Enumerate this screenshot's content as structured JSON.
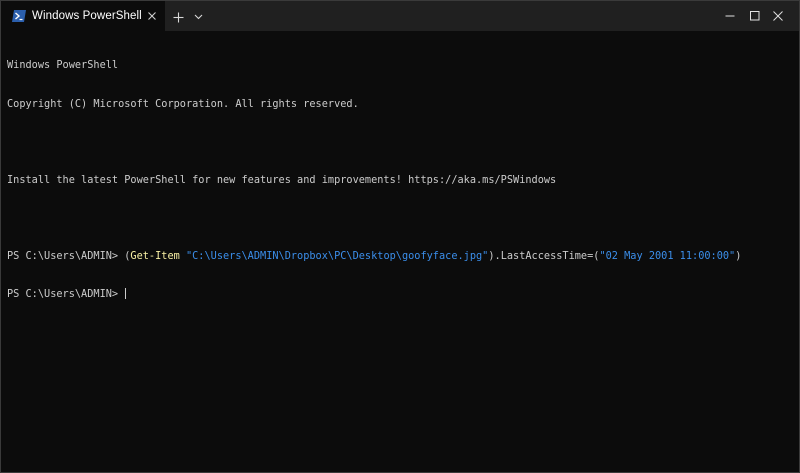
{
  "window": {
    "tab_title": "Windows PowerShell",
    "tab_icon": "powershell-icon",
    "controls": {
      "new_tab": "plus-icon",
      "dropdown": "chevron-down-icon",
      "minimize": "minimize-icon",
      "maximize": "maximize-icon",
      "close": "close-icon"
    }
  },
  "terminal": {
    "line1": "Windows PowerShell",
    "line2": "Copyright (C) Microsoft Corporation. All rights reserved.",
    "line3": "Install the latest PowerShell for new features and improvements! https://aka.ms/PSWindows",
    "prompt": "PS C:\\Users\\ADMIN> ",
    "cmd": {
      "open_paren": "(",
      "cmdlet": "Get-Item",
      "space": " ",
      "path_arg": "\"C:\\Users\\ADMIN\\Dropbox\\PC\\Desktop\\goofyface.jpg\"",
      "property": ").LastAccessTime=(",
      "date_arg": "\"02 May 2001 11:00:00\"",
      "close_paren": ")"
    },
    "colors": {
      "background": "#0c0c0c",
      "foreground": "#cccccc",
      "cmdlet": "#f9f1a5",
      "string": "#3b8eea"
    }
  }
}
